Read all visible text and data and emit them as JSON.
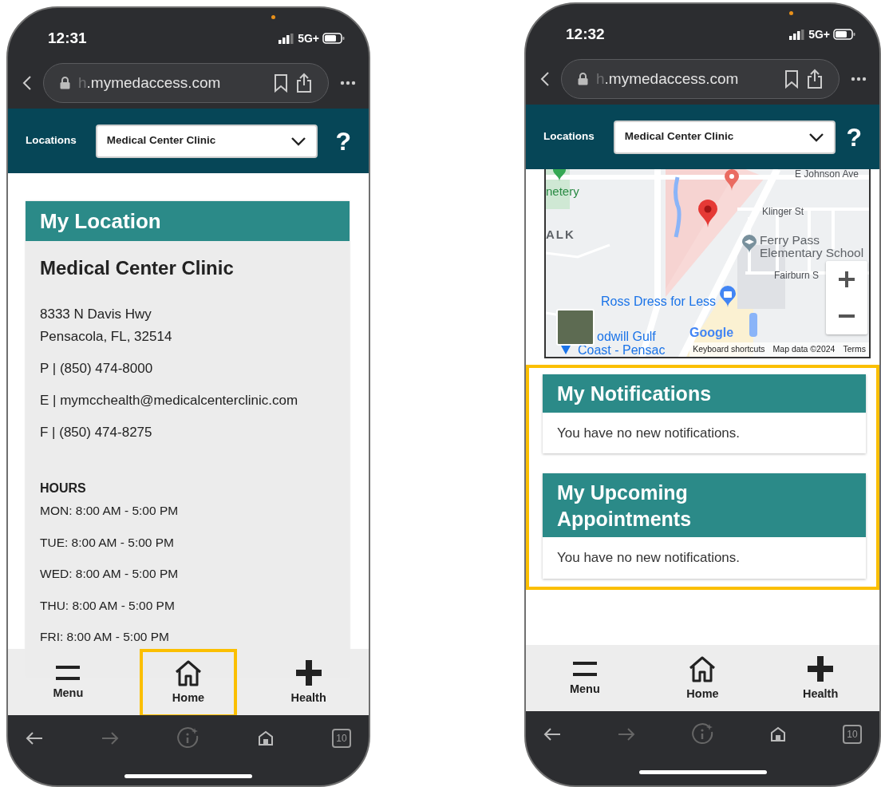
{
  "phones": [
    {
      "status": {
        "time": "12:31",
        "network": "5G+"
      },
      "browser": {
        "url": "h.mymedaccess.com",
        "tab_count": "10"
      },
      "header": {
        "label": "Locations",
        "location": "Medical Center Clinic",
        "help": "?"
      },
      "content": {
        "kind": "location",
        "title": "My Location",
        "name": "Medical Center Clinic",
        "address": [
          "8333 N Davis Hwy",
          "Pensacola, FL, 32514"
        ],
        "contacts": [
          "P | (850) 474-8000",
          "E | mymcchealth@medicalcenterclinic.com",
          "F | (850) 474-8275"
        ],
        "hours_title": "HOURS",
        "hours": [
          "MON: 8:00 AM - 5:00 PM",
          "TUE: 8:00 AM - 5:00 PM",
          "WED: 8:00 AM - 5:00 PM",
          "THU: 8:00 AM - 5:00 PM",
          "FRI: 8:00 AM - 5:00 PM"
        ]
      },
      "nav": [
        {
          "label": "Menu",
          "kind": "menu",
          "highlighted": false
        },
        {
          "label": "Home",
          "kind": "home",
          "highlighted": true
        },
        {
          "label": "Health",
          "kind": "health",
          "highlighted": false
        }
      ]
    },
    {
      "status": {
        "time": "12:32",
        "network": "5G+"
      },
      "browser": {
        "url": "h.mymedaccess.com",
        "tab_count": "10"
      },
      "header": {
        "label": "Locations",
        "location": "Medical Center Clinic",
        "help": "?"
      },
      "content": {
        "kind": "dashboard",
        "map": {
          "labels": [
            {
              "text": "E Johnson Ave",
              "kind": "road"
            },
            {
              "text": "netery",
              "kind": "park"
            },
            {
              "text": "ALK",
              "kind": "area"
            },
            {
              "text": "Klinger St",
              "kind": "road"
            },
            {
              "text": "Ferry Pass",
              "kind": "poi"
            },
            {
              "text": "Elementary School",
              "kind": "poi"
            },
            {
              "text": "Fairburn S",
              "kind": "road"
            },
            {
              "text": "Ross Dress for Less",
              "kind": "shop"
            },
            {
              "text": "odwill Gulf",
              "kind": "shop"
            },
            {
              "text": "Coast - Pensac",
              "kind": "shop"
            },
            {
              "text": "Google",
              "kind": "logo"
            }
          ],
          "attribution": [
            "Keyboard shortcuts",
            "Map data ©2024",
            "Terms"
          ]
        },
        "highlighted": true,
        "cards": [
          {
            "title": "My Notifications",
            "message": "You have no new notifications."
          },
          {
            "title": "My Upcoming Appointments",
            "message": "You have no new notifications."
          }
        ]
      },
      "nav": [
        {
          "label": "Menu",
          "kind": "menu",
          "highlighted": false
        },
        {
          "label": "Home",
          "kind": "home",
          "highlighted": false
        },
        {
          "label": "Health",
          "kind": "health",
          "highlighted": false
        }
      ]
    }
  ]
}
